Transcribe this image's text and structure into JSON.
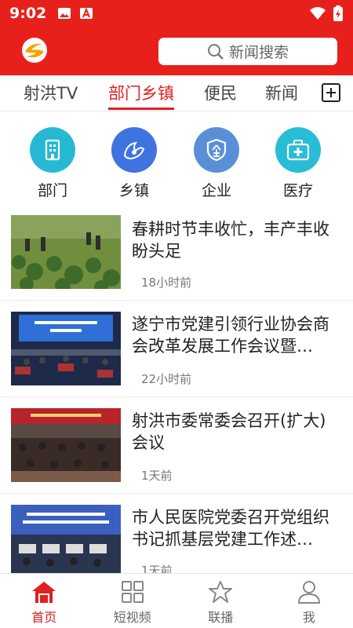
{
  "status_bar": {
    "time": "9:02"
  },
  "header": {
    "search_placeholder": "新闻搜索"
  },
  "tabs": [
    {
      "label": "射洪TV"
    },
    {
      "label": "部门乡镇",
      "active": true
    },
    {
      "label": "便民"
    },
    {
      "label": "新闻"
    }
  ],
  "categories": [
    {
      "label": "部门",
      "icon": "building-icon",
      "color": "#27b9d4"
    },
    {
      "label": "乡镇",
      "icon": "village-icon",
      "color": "#3f73e0"
    },
    {
      "label": "企业",
      "icon": "enterprise-icon",
      "color": "#5a8fd8"
    },
    {
      "label": "医疗",
      "icon": "medical-kit-icon",
      "color": "#29bcd6"
    }
  ],
  "news": [
    {
      "title": "春耕时节丰收忙，丰产丰收盼头足",
      "time": "18小时前"
    },
    {
      "title": "遂宁市党建引领行业协会商会改革发展工作会议暨…",
      "time": "22小时前"
    },
    {
      "title": "射洪市委常委会召开(扩大)会议",
      "time": "1天前"
    },
    {
      "title": "市人民医院党委召开党组织书记抓基层党建工作述…",
      "time": "1天前"
    }
  ],
  "bottom_nav": [
    {
      "label": "首页",
      "active": true
    },
    {
      "label": "短视频"
    },
    {
      "label": "联播"
    },
    {
      "label": "我"
    }
  ],
  "colors": {
    "brand": "#e8201b",
    "active": "#e02020"
  }
}
